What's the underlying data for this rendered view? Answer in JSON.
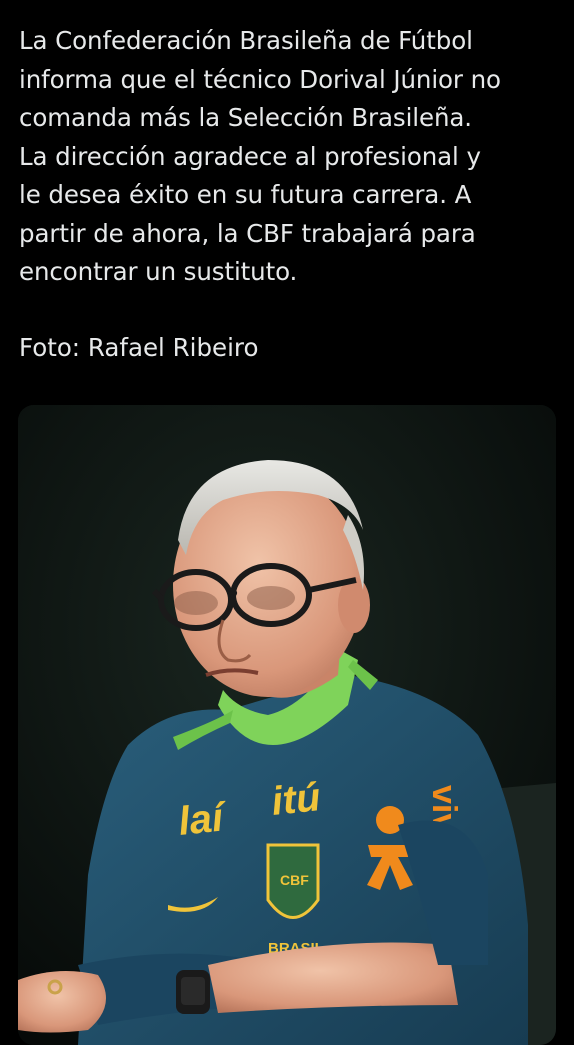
{
  "post": {
    "text_lines": [
      "La Confederación Brasileña de Fútbol",
      "informa que el técnico Dorival Júnior no",
      "comanda más la Selección Brasileña.",
      "La dirección agradece al profesional y",
      "le desea éxito en su futura carrera. A",
      "partir de ahora, la CBF trabajará para",
      "encontrar un sustituto."
    ],
    "credit": "Foto: Rafael Ribeiro"
  },
  "photo": {
    "shirt_text_left": "laí",
    "shirt_text_right": "itú",
    "sponsor": "vivo",
    "crest_text": "CBF",
    "crest_caption": "BRASIL",
    "colors": {
      "background": "#000000",
      "text": "#e7e9ea",
      "shirt": "#1f4f6b",
      "collar": "#7fd35a",
      "sponsor_orange": "#f08a1c"
    }
  }
}
